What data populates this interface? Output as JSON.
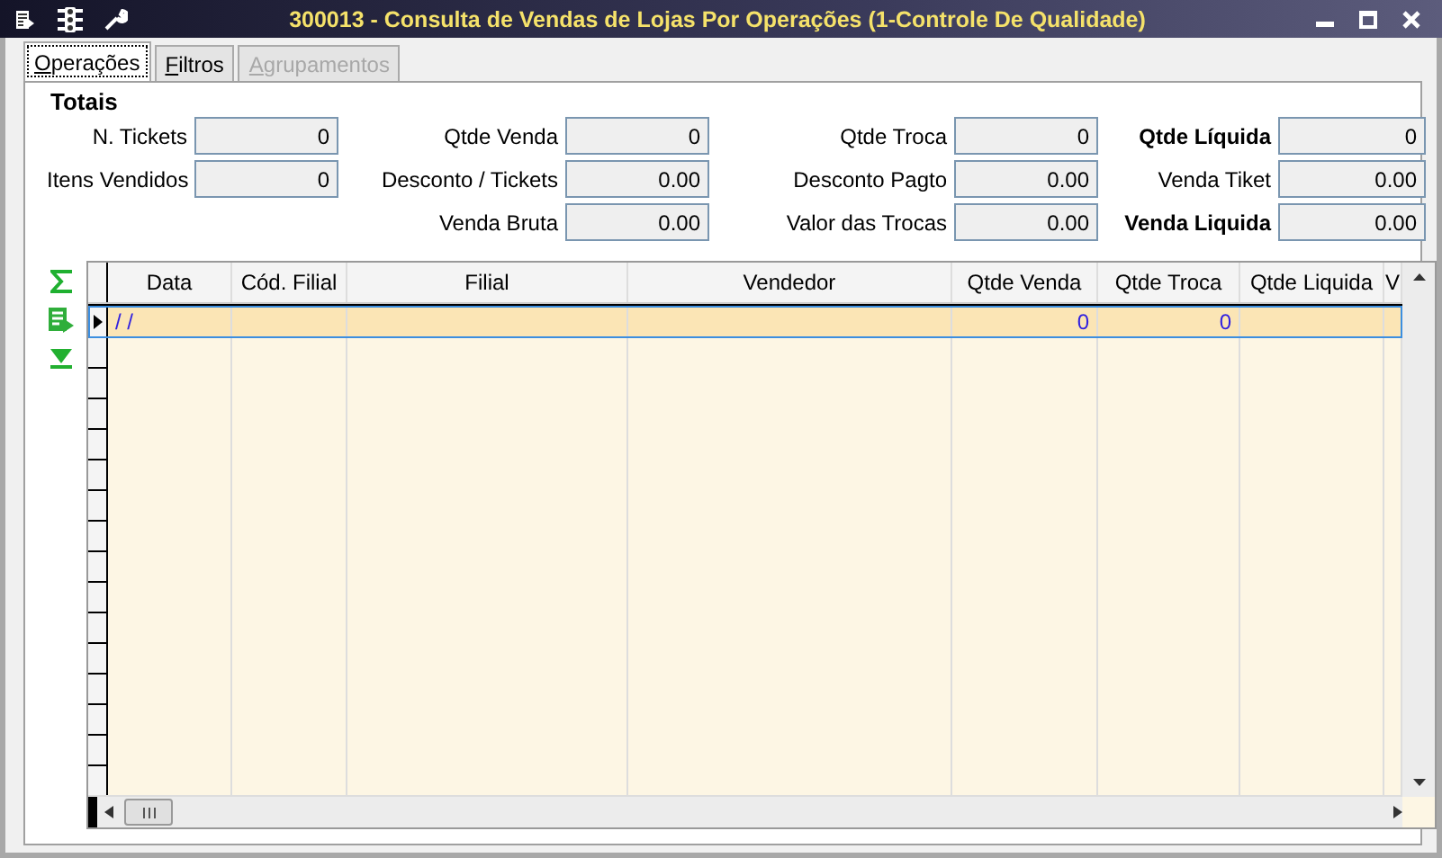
{
  "window": {
    "title": "300013 - Consulta de Vendas de Lojas Por Operações (1-Controle De Qualidade)"
  },
  "tabs": [
    {
      "label": "Operações",
      "selected": true,
      "disabled": false
    },
    {
      "label": "Filtros",
      "selected": false,
      "disabled": false
    },
    {
      "label": "Agrupamentos",
      "selected": false,
      "disabled": true
    }
  ],
  "totals": {
    "title": "Totais",
    "columns": [
      [
        {
          "label": "N. Tickets",
          "value": "0",
          "bold": false
        },
        {
          "label": "Itens Vendidos",
          "value": "0",
          "bold": false
        }
      ],
      [
        {
          "label": "Qtde Venda",
          "value": "0",
          "bold": false
        },
        {
          "label": "Desconto / Tickets",
          "value": "0.00",
          "bold": false
        },
        {
          "label": "Venda Bruta",
          "value": "0.00",
          "bold": false
        }
      ],
      [
        {
          "label": "Qtde Troca",
          "value": "0",
          "bold": false
        },
        {
          "label": "Desconto Pagto",
          "value": "0.00",
          "bold": false
        },
        {
          "label": "Valor das Trocas",
          "value": "0.00",
          "bold": false
        }
      ],
      [
        {
          "label": "Qtde Líquida",
          "value": "0",
          "bold": true
        },
        {
          "label": "Venda Tiket",
          "value": "0.00",
          "bold": false
        },
        {
          "label": "Venda Liquida",
          "value": "0.00",
          "bold": true
        }
      ]
    ]
  },
  "grid": {
    "columns": [
      "Data",
      "Cód. Filial",
      "Filial",
      "Vendedor",
      "Qtde Venda",
      "Qtde Troca",
      "Qtde Liquida",
      "V"
    ],
    "rows": [
      {
        "selected": true,
        "cells": [
          "/ /",
          "",
          "",
          "",
          "0",
          "0",
          "",
          ""
        ]
      }
    ]
  }
}
